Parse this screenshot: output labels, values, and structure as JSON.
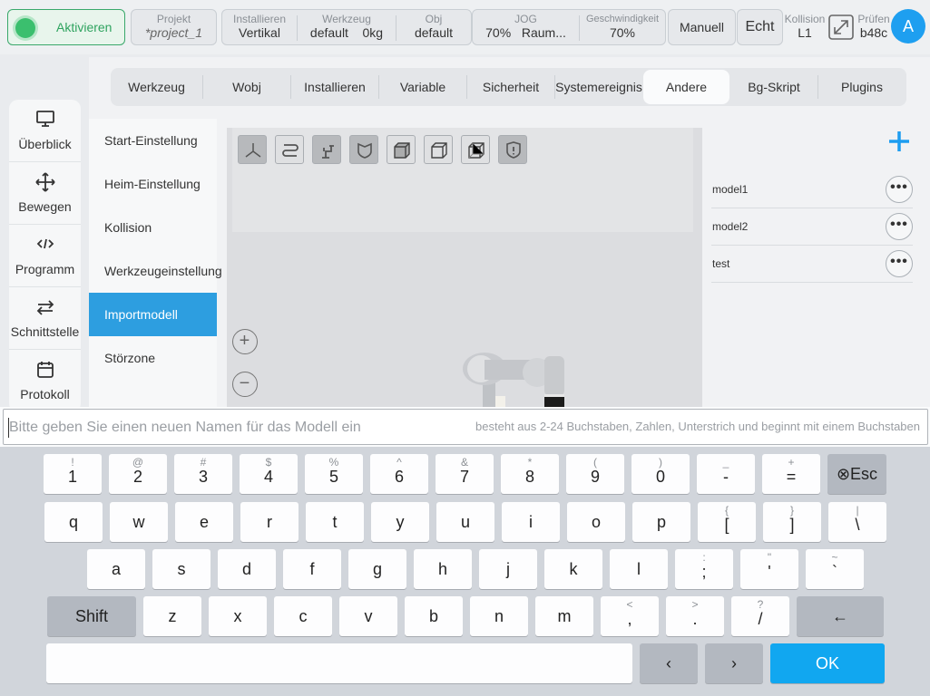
{
  "topbar": {
    "activate": "Aktivieren",
    "project": {
      "caption": "Projekt",
      "value": "*project_1"
    },
    "install": {
      "caption": "Installieren",
      "value": "Vertikal"
    },
    "tool": {
      "caption": "Werkzeug",
      "value": "default",
      "value2": "0kg"
    },
    "obj": {
      "caption": "Obj",
      "value": "default"
    },
    "jog": {
      "caption": "JOG",
      "value": "70%",
      "value2": "Raum..."
    },
    "speed": {
      "caption": "Geschwindigkeit",
      "value": "70%"
    },
    "mode_manual": "Manuell",
    "mode_real": "Echt",
    "collision": {
      "caption": "Kollision",
      "value": "L1"
    },
    "check": {
      "caption": "Prüfen",
      "value": "b48c"
    },
    "avatar": "A"
  },
  "leftnav": [
    {
      "label": "Überblick",
      "icon": "monitor-icon"
    },
    {
      "label": "Bewegen",
      "icon": "move-icon"
    },
    {
      "label": "Programm",
      "icon": "code-icon"
    },
    {
      "label": "Schnittstelle",
      "icon": "interface-icon"
    },
    {
      "label": "Protokoll",
      "icon": "calendar-icon"
    }
  ],
  "tabs": [
    "Werkzeug",
    "Wobj",
    "Installieren",
    "Variable",
    "Sicherheit",
    "Systemereignis",
    "Andere",
    "Bg-Skript",
    "Plugins"
  ],
  "active_tab": "Andere",
  "submenu": [
    "Start-Einstellung",
    "Heim-Einstellung",
    "Kollision",
    "Werkzeugeinstellung",
    "Importmodell",
    "Störzone"
  ],
  "active_submenu": "Importmodell",
  "viewer_tools": [
    "axes-icon",
    "path-icon",
    "robot-icon",
    "shield-icon",
    "cube-front-icon",
    "cube-side-icon",
    "cube-top-icon",
    "alert-shield-icon"
  ],
  "models": [
    "model1",
    "model2",
    "test"
  ],
  "input": {
    "placeholder": "Bitte geben Sie einen neuen Namen für das Modell ein",
    "hint": "besteht aus 2-24 Buchstaben, Zahlen, Unterstrich und beginnt mit einem Buchstaben"
  },
  "keyboard": {
    "row1": [
      [
        "1",
        "!"
      ],
      [
        "2",
        "@"
      ],
      [
        "3",
        "#"
      ],
      [
        "4",
        "$"
      ],
      [
        "5",
        "%"
      ],
      [
        "6",
        "^"
      ],
      [
        "7",
        "&"
      ],
      [
        "8",
        "*"
      ],
      [
        "9",
        "("
      ],
      [
        "0",
        ")"
      ],
      [
        "-",
        "_"
      ],
      [
        "=",
        "+"
      ]
    ],
    "esc": "⊗Esc",
    "row2": [
      [
        "q",
        ""
      ],
      [
        "w",
        ""
      ],
      [
        "e",
        ""
      ],
      [
        "r",
        ""
      ],
      [
        "t",
        ""
      ],
      [
        "y",
        ""
      ],
      [
        "u",
        ""
      ],
      [
        "i",
        ""
      ],
      [
        "o",
        ""
      ],
      [
        "p",
        ""
      ],
      [
        "[",
        "{"
      ],
      [
        "]",
        "}"
      ],
      [
        "\\",
        "|"
      ]
    ],
    "row3": [
      [
        "a",
        ""
      ],
      [
        "s",
        ""
      ],
      [
        "d",
        ""
      ],
      [
        "f",
        ""
      ],
      [
        "g",
        ""
      ],
      [
        "h",
        ""
      ],
      [
        "j",
        ""
      ],
      [
        "k",
        ""
      ],
      [
        "l",
        ""
      ],
      [
        ";",
        ":"
      ],
      [
        "'",
        "\""
      ],
      [
        "`",
        "~"
      ]
    ],
    "shift": "Shift",
    "row4": [
      [
        "z",
        ""
      ],
      [
        "x",
        ""
      ],
      [
        "c",
        ""
      ],
      [
        "v",
        ""
      ],
      [
        "b",
        ""
      ],
      [
        "n",
        ""
      ],
      [
        "m",
        ""
      ],
      [
        ",",
        "<"
      ],
      [
        ".",
        ">"
      ],
      [
        "/",
        "?"
      ]
    ],
    "backspace": "←",
    "left": "‹",
    "right": "›",
    "ok": "OK"
  },
  "colors": {
    "accent": "#11a7f0",
    "active_submenu": "#2d9ee0",
    "activate_green": "#3bbf6e"
  }
}
